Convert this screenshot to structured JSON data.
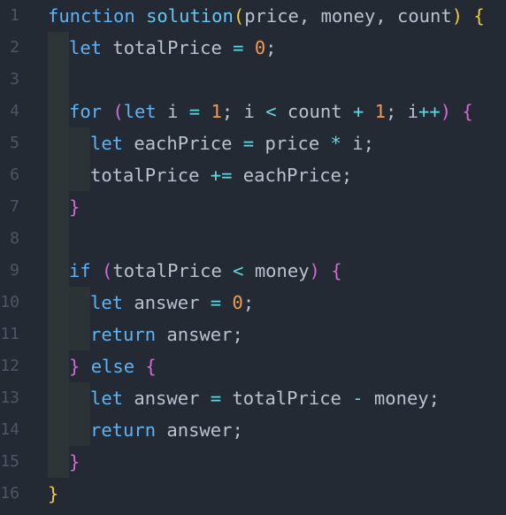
{
  "editor": {
    "language": "javascript",
    "lines": [
      {
        "no": "1",
        "indent": 0,
        "tokens": [
          [
            "k",
            "function"
          ],
          [
            "p",
            " "
          ],
          [
            "f",
            "solution"
          ],
          [
            "b1",
            "("
          ],
          [
            "p",
            "price, money, count"
          ],
          [
            "b1",
            ")"
          ],
          [
            "p",
            " "
          ],
          [
            "b1",
            "{"
          ]
        ]
      },
      {
        "no": "2",
        "indent": 1,
        "tokens": [
          [
            "k",
            "let"
          ],
          [
            "p",
            " totalPrice "
          ],
          [
            "o",
            "="
          ],
          [
            "p",
            " "
          ],
          [
            "n",
            "0"
          ],
          [
            "p",
            ";"
          ]
        ]
      },
      {
        "no": "3",
        "indent": 1,
        "tokens": []
      },
      {
        "no": "4",
        "indent": 1,
        "tokens": [
          [
            "k",
            "for"
          ],
          [
            "p",
            " "
          ],
          [
            "b2",
            "("
          ],
          [
            "k",
            "let"
          ],
          [
            "p",
            " i "
          ],
          [
            "o",
            "="
          ],
          [
            "p",
            " "
          ],
          [
            "n",
            "1"
          ],
          [
            "p",
            "; i "
          ],
          [
            "o",
            "<"
          ],
          [
            "p",
            " count "
          ],
          [
            "o",
            "+"
          ],
          [
            "p",
            " "
          ],
          [
            "n",
            "1"
          ],
          [
            "p",
            "; i"
          ],
          [
            "o",
            "++"
          ],
          [
            "b2",
            ")"
          ],
          [
            "p",
            " "
          ],
          [
            "b2",
            "{"
          ]
        ]
      },
      {
        "no": "5",
        "indent": 2,
        "tokens": [
          [
            "k",
            "let"
          ],
          [
            "p",
            " eachPrice "
          ],
          [
            "o",
            "="
          ],
          [
            "p",
            " price "
          ],
          [
            "o",
            "*"
          ],
          [
            "p",
            " i;"
          ]
        ]
      },
      {
        "no": "6",
        "indent": 2,
        "tokens": [
          [
            "p",
            "totalPrice "
          ],
          [
            "o",
            "+="
          ],
          [
            "p",
            " eachPrice;"
          ]
        ]
      },
      {
        "no": "7",
        "indent": 1,
        "tokens": [
          [
            "b2",
            "}"
          ]
        ]
      },
      {
        "no": "8",
        "indent": 1,
        "tokens": []
      },
      {
        "no": "9",
        "indent": 1,
        "tokens": [
          [
            "k",
            "if"
          ],
          [
            "p",
            " "
          ],
          [
            "b2",
            "("
          ],
          [
            "p",
            "totalPrice "
          ],
          [
            "o",
            "<"
          ],
          [
            "p",
            " money"
          ],
          [
            "b2",
            ")"
          ],
          [
            "p",
            " "
          ],
          [
            "b2",
            "{"
          ]
        ]
      },
      {
        "no": "10",
        "indent": 2,
        "tokens": [
          [
            "k",
            "let"
          ],
          [
            "p",
            " answer "
          ],
          [
            "o",
            "="
          ],
          [
            "p",
            " "
          ],
          [
            "n",
            "0"
          ],
          [
            "p",
            ";"
          ]
        ]
      },
      {
        "no": "11",
        "indent": 2,
        "tokens": [
          [
            "k",
            "return"
          ],
          [
            "p",
            " answer;"
          ]
        ]
      },
      {
        "no": "12",
        "indent": 1,
        "tokens": [
          [
            "b2",
            "}"
          ],
          [
            "p",
            " "
          ],
          [
            "k",
            "else"
          ],
          [
            "p",
            " "
          ],
          [
            "b2",
            "{"
          ]
        ]
      },
      {
        "no": "13",
        "indent": 2,
        "tokens": [
          [
            "k",
            "let"
          ],
          [
            "p",
            " answer "
          ],
          [
            "o",
            "="
          ],
          [
            "p",
            " totalPrice "
          ],
          [
            "o",
            "-"
          ],
          [
            "p",
            " money;"
          ]
        ]
      },
      {
        "no": "14",
        "indent": 2,
        "tokens": [
          [
            "k",
            "return"
          ],
          [
            "p",
            " answer;"
          ]
        ]
      },
      {
        "no": "15",
        "indent": 1,
        "tokens": [
          [
            "b2",
            "}"
          ]
        ]
      },
      {
        "no": "16",
        "indent": 0,
        "tokens": [
          [
            "b1",
            "}"
          ]
        ]
      }
    ]
  },
  "colors": {
    "background": "#242a33",
    "line_number": "#4d5666",
    "keyword": "#5fb3f5",
    "function_name": "#66c6f2",
    "plain": "#b9c2d0",
    "outer_brace": "#f2cc33",
    "inner_brace": "#d06ad6",
    "number": "#f09a55",
    "operator": "#5fd8e6"
  }
}
